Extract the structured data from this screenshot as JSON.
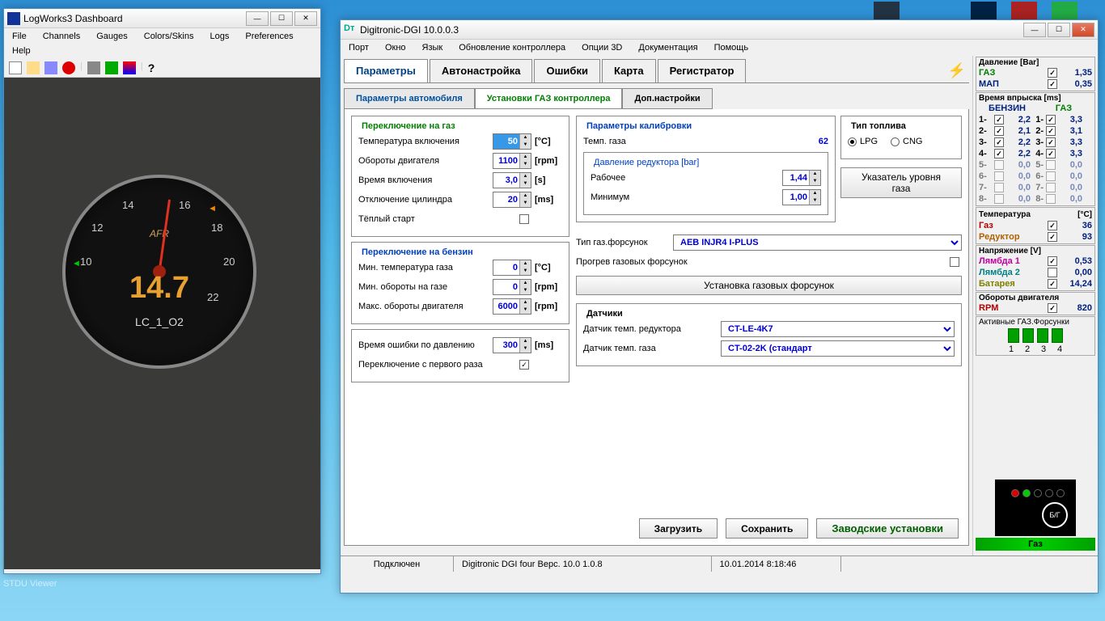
{
  "taskbar_stdu": "STDU Viewer",
  "logworks": {
    "title": "LogWorks3 Dashboard",
    "menu": [
      "File",
      "Channels",
      "Gauges",
      "Colors/Skins",
      "Logs",
      "Preferences",
      "Help"
    ],
    "gauge": {
      "label": "AFR",
      "value": "14.7",
      "name": "LC_1_O2",
      "ticks": {
        "t10": "10",
        "t12": "12",
        "t14": "14",
        "t16": "16",
        "t18": "18",
        "t20": "20",
        "t22": "22"
      }
    }
  },
  "digi": {
    "title": "Digitronic-DGI 10.0.0.3",
    "menu": [
      "Порт",
      "Окно",
      "Язык",
      "Обновление контроллера",
      "Опции 3D",
      "Документация",
      "Помощь"
    ],
    "tabs": [
      "Параметры",
      "Автонастройка",
      "Ошибки",
      "Карта",
      "Регистратор"
    ],
    "subtabs": [
      "Параметры автомобиля",
      "Установки ГАЗ контроллера",
      "Доп.настройки"
    ],
    "switchGas": {
      "title": "Переключение на газ",
      "tempOn_l": "Температура включения",
      "tempOn_v": "50",
      "tempOn_u": "[°C]",
      "rpm_l": "Обороты двигателя",
      "rpm_v": "1100",
      "rpm_u": "[rpm]",
      "timeOn_l": "Время включения",
      "timeOn_v": "3,0",
      "timeOn_u": "[s]",
      "cylOff_l": "Отключение цилиндра",
      "cylOff_v": "20",
      "cylOff_u": "[ms]",
      "warm_l": "Тёплый старт"
    },
    "switchPetrol": {
      "title": "Переключение на бензин",
      "minTemp_l": "Мин. температура газа",
      "minTemp_v": "0",
      "minTemp_u": "[°C]",
      "minRpm_l": "Мин. обороты на газе",
      "minRpm_v": "0",
      "minRpm_u": "[rpm]",
      "maxRpm_l": "Макс. обороты двигателя",
      "maxRpm_v": "6000",
      "maxRpm_u": "[rpm]"
    },
    "errTime_l": "Время ошибки по давлению",
    "errTime_v": "300",
    "errTime_u": "[ms]",
    "firstSwitch_l": "Переключение с первого раза",
    "calib": {
      "title": "Параметры калибровки",
      "gasTemp_l": "Темп. газа",
      "gasTemp_v": "62",
      "press_title": "Давление редуктора [bar]",
      "work_l": "Рабочее",
      "work_v": "1,44",
      "min_l": "Минимум",
      "min_v": "1,00"
    },
    "fuel": {
      "title": "Тип топлива",
      "lpg": "LPG",
      "cng": "CNG"
    },
    "level_btn": "Указатель уровня газа",
    "injType_l": "Тип газ.форсунок",
    "injType_v": "AEB INJR4 I-PLUS",
    "warmInj_l": "Прогрев газовых форсунок",
    "setupInj_btn": "Установка газовых форсунок",
    "sensors": {
      "title": "Датчики",
      "red_l": "Датчик темп. редуктора",
      "red_v": "CT-LE-4K7",
      "gas_l": "Датчик темп. газа",
      "gas_v": "CT-02-2K (стандарт"
    },
    "buttons": {
      "load": "Загрузить",
      "save": "Сохранить",
      "factory": "Заводские установки"
    },
    "status": {
      "conn": "Подключен",
      "ver": "Digitronic DGI four   Верс. 10.0  1.0.8",
      "date": "10.01.2014 8:18:46"
    },
    "side": {
      "pressure_t": "Давление [Bar]",
      "gas_l": "ГАЗ",
      "gas_v": "1,35",
      "map_l": "МАП",
      "map_v": "0,35",
      "inj_t": "Время впрыска [ms]",
      "benzin": "БЕНЗИН",
      "gaz": "ГАЗ",
      "inj_rows": [
        {
          "n": "1",
          "b": "2,2",
          "g": "3,3"
        },
        {
          "n": "2",
          "b": "2,1",
          "g": "3,1"
        },
        {
          "n": "3",
          "b": "2,2",
          "g": "3,3"
        },
        {
          "n": "4",
          "b": "2,2",
          "g": "3,3"
        },
        {
          "n": "5",
          "b": "0,0",
          "g": "0,0"
        },
        {
          "n": "6",
          "b": "0,0",
          "g": "0,0"
        },
        {
          "n": "7",
          "b": "0,0",
          "g": "0,0"
        },
        {
          "n": "8",
          "b": "0,0",
          "g": "0,0"
        }
      ],
      "temp_t": "Температура",
      "temp_u": "[°C]",
      "tgas_l": "Газ",
      "tgas_v": "36",
      "tred_l": "Редуктор",
      "tred_v": "93",
      "volt_t": "Напряжение [V]",
      "l1_l": "Лямбда 1",
      "l1_v": "0,53",
      "l2_l": "Лямбда 2",
      "l2_v": "0,00",
      "bat_l": "Батарея",
      "bat_v": "14,24",
      "rpm_t": "Обороты двигателя",
      "rpm_l": "RPM",
      "rpm_v": "820",
      "activeInj_t": "Активные ГАЗ.Форсунки",
      "injNums": [
        "1",
        "2",
        "3",
        "4"
      ],
      "bg": "Б/Г",
      "mode": "Газ"
    }
  }
}
